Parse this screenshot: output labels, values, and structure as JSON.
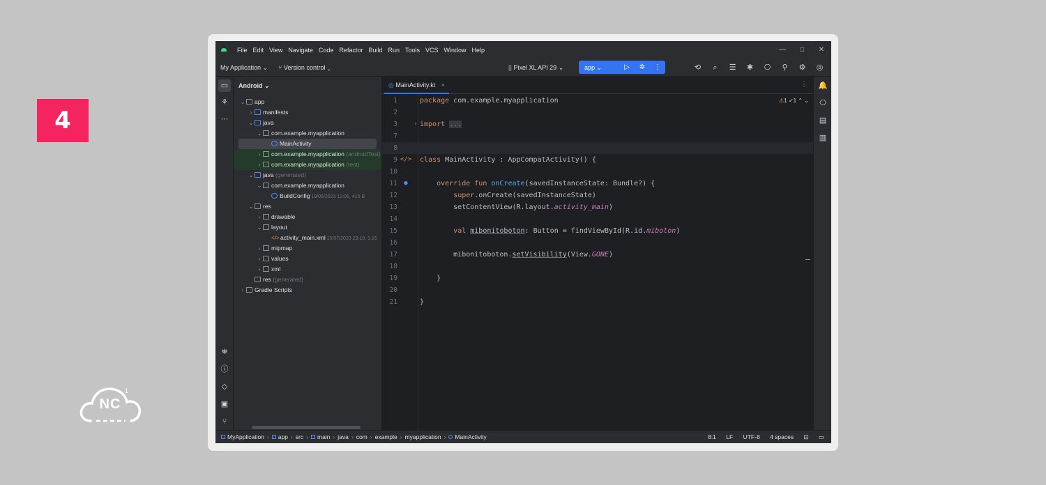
{
  "step_number": "4",
  "logo_text": "NC",
  "menu": [
    "File",
    "Edit",
    "View",
    "Navigate",
    "Code",
    "Refactor",
    "Build",
    "Run",
    "Tools",
    "VCS",
    "Window",
    "Help"
  ],
  "window_controls": [
    "—",
    "□",
    "✕"
  ],
  "toolbar": {
    "project": "My Application",
    "vcs": "Version control",
    "device": "Pixel XL API 29",
    "run_config": "app"
  },
  "project_panel": {
    "view": "Android",
    "tree": [
      {
        "label": "app",
        "indent": 0,
        "arrow": "⌄",
        "icon": "folder"
      },
      {
        "label": "manifests",
        "indent": 1,
        "arrow": "›",
        "icon": "folder-blue"
      },
      {
        "label": "java",
        "indent": 1,
        "arrow": "⌄",
        "icon": "folder-blue"
      },
      {
        "label": "com.example.myapplication",
        "indent": 2,
        "arrow": "⌄",
        "icon": "package"
      },
      {
        "label": "MainActivity",
        "indent": 3,
        "arrow": "",
        "icon": "kotlin",
        "selected": true
      },
      {
        "label": "com.example.myapplication",
        "suffix": "(androidTest)",
        "indent": 2,
        "arrow": "›",
        "icon": "package",
        "tested": true
      },
      {
        "label": "com.example.myapplication",
        "suffix": "(test)",
        "indent": 2,
        "arrow": "›",
        "icon": "package",
        "tested": true
      },
      {
        "label": "java",
        "suffix": "(generated)",
        "indent": 1,
        "arrow": "⌄",
        "icon": "folder-blue"
      },
      {
        "label": "com.example.myapplication",
        "indent": 2,
        "arrow": "⌄",
        "icon": "package"
      },
      {
        "label": "BuildConfig",
        "meta": "19/05/2023 13:06, 415 B",
        "indent": 3,
        "arrow": "",
        "icon": "kotlin"
      },
      {
        "label": "res",
        "indent": 1,
        "arrow": "⌄",
        "icon": "folder"
      },
      {
        "label": "drawable",
        "indent": 2,
        "arrow": "›",
        "icon": "folder"
      },
      {
        "label": "layout",
        "indent": 2,
        "arrow": "⌄",
        "icon": "folder"
      },
      {
        "label": "activity_main.xml",
        "meta": "15/07/2023 23:19, 1.16",
        "indent": 3,
        "arrow": "",
        "icon": "xml"
      },
      {
        "label": "mipmap",
        "indent": 2,
        "arrow": "›",
        "icon": "folder"
      },
      {
        "label": "values",
        "indent": 2,
        "arrow": "›",
        "icon": "folder"
      },
      {
        "label": "xml",
        "indent": 2,
        "arrow": "›",
        "icon": "folder"
      },
      {
        "label": "res",
        "suffix": "(generated)",
        "indent": 1,
        "arrow": "",
        "icon": "folder"
      },
      {
        "label": "Gradle Scripts",
        "indent": 0,
        "arrow": "›",
        "icon": "gradle"
      }
    ]
  },
  "editor": {
    "tab": "MainActivity.kt",
    "inspections": {
      "warnings": "1",
      "ok": "1"
    },
    "current_line": 8,
    "lines": [
      {
        "n": "1",
        "html": "<span class=\"kw\">package</span> com.example.myapplication"
      },
      {
        "n": "2",
        "html": ""
      },
      {
        "n": "3",
        "html": "<span class=\"kw\">import</span> <span class=\"fold\">...</span>"
      },
      {
        "n": "7",
        "html": ""
      },
      {
        "n": "8",
        "html": ""
      },
      {
        "n": "9",
        "html": "<span class=\"kw\">class</span> MainActivity : AppCompatActivity() {"
      },
      {
        "n": "10",
        "html": ""
      },
      {
        "n": "11",
        "html": "    <span class=\"kw\">override fun</span> <span class=\"fn\">onCreate</span>(savedInstanceState: Bundle?) {"
      },
      {
        "n": "12",
        "html": "        <span class=\"kw\">super</span>.onCreate(savedInstanceState)"
      },
      {
        "n": "13",
        "html": "        setContentView(R.layout.<span class=\"it\">activity_main</span>)"
      },
      {
        "n": "14",
        "html": ""
      },
      {
        "n": "15",
        "html": "        <span class=\"kw\">val</span> <span class=\"und\">mibonitoboton</span>: Button = findViewById(R.id.<span class=\"it\">miboton</span>)"
      },
      {
        "n": "16",
        "html": ""
      },
      {
        "n": "17",
        "html": "        mibonitoboton.<span class=\"und\">setVisibility</span>(View.<span class=\"it\">GONE</span>)"
      },
      {
        "n": "18",
        "html": ""
      },
      {
        "n": "19",
        "html": "    }"
      },
      {
        "n": "20",
        "html": ""
      },
      {
        "n": "21",
        "html": "}"
      }
    ]
  },
  "statusbar": {
    "crumbs": [
      "MyApplication",
      "app",
      "src",
      "main",
      "java",
      "com",
      "example",
      "myapplication",
      "MainActivity"
    ],
    "position": "8:1",
    "line_sep": "LF",
    "encoding": "UTF-8",
    "indent": "4 spaces"
  },
  "colors": {
    "accent": "#3574f0",
    "badge": "#f3245f",
    "keyword": "#cf8e6d",
    "function": "#56a8f5"
  }
}
